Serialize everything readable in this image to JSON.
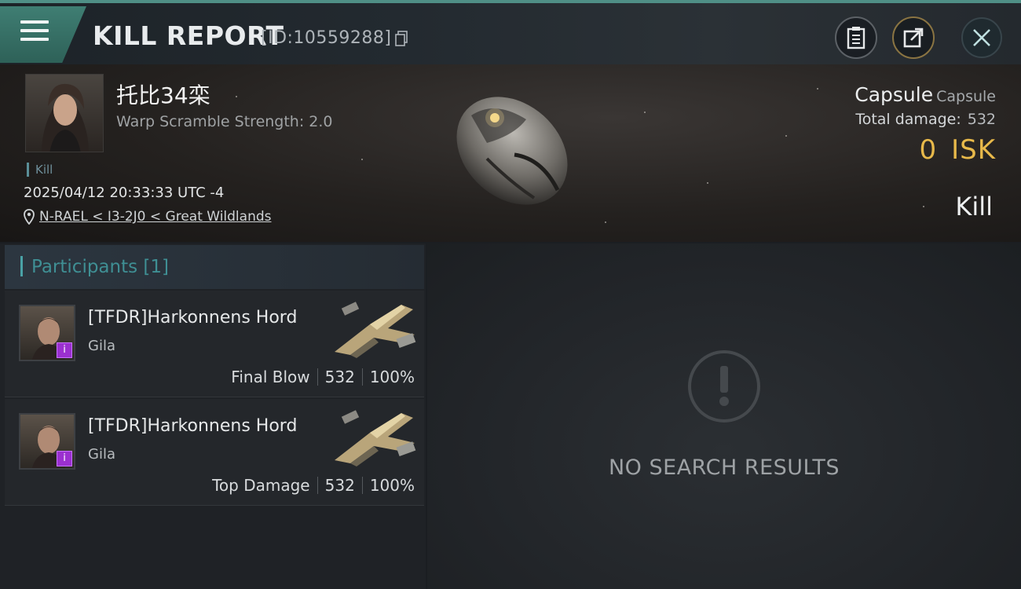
{
  "header": {
    "title": "KILL REPORT",
    "report_id": "[ID:10559288]"
  },
  "victim": {
    "pilot_name": "托比34栾",
    "warp_scramble": "Warp Scramble Strength: 2.0",
    "kill_tag": "Kill",
    "datetime": "2025/04/12 20:33:33 UTC -4",
    "location": "N-RAEL < I3-2J0 < Great Wildlands",
    "ship_name": "Capsule",
    "ship_type": "Capsule",
    "total_damage_label": "Total damage:",
    "total_damage_value": "532",
    "isk_value": "0",
    "isk_unit": "ISK",
    "result_label": "Kill"
  },
  "participants": {
    "label": "Participants",
    "count": "[1]",
    "items": [
      {
        "name": "[TFDR]Harkonnens Hord",
        "ship": "Gila",
        "role": "Final Blow",
        "damage": "532",
        "percent": "100%",
        "badge": "i"
      },
      {
        "name": "[TFDR]Harkonnens Hord",
        "ship": "Gila",
        "role": "Top Damage",
        "damage": "532",
        "percent": "100%",
        "badge": "i"
      }
    ]
  },
  "results": {
    "empty_text": "NO SEARCH RESULTS"
  },
  "colors": {
    "accent": "#4f8f86",
    "isk": "#e8b94a",
    "badge": "#9b30d0"
  }
}
